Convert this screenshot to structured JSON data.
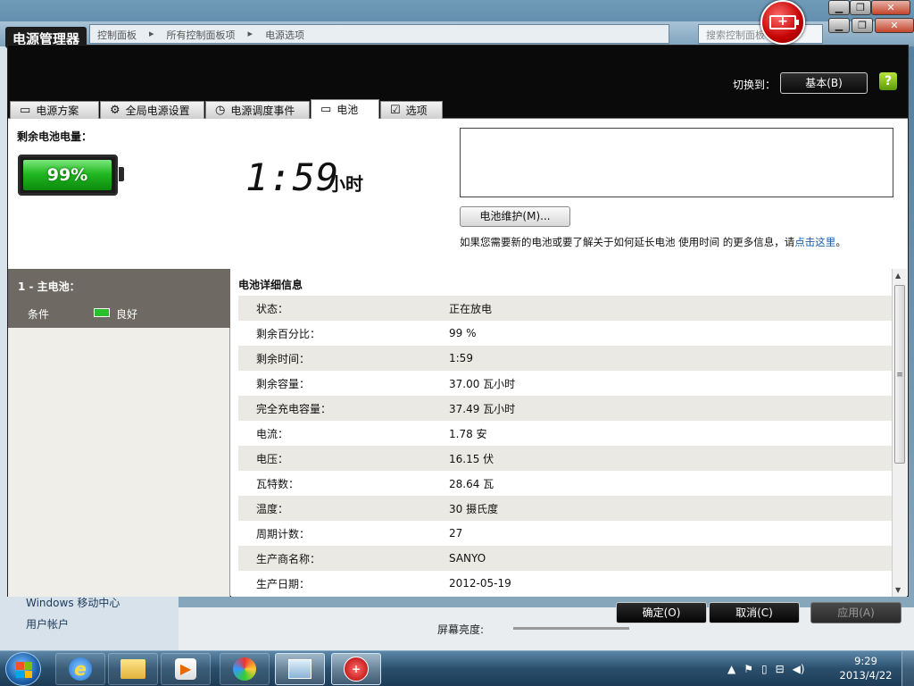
{
  "background_window": {
    "breadcrumb": [
      "控制面板",
      "所有控制面板项",
      "电源选项"
    ],
    "search_placeholder": "搜索控制面板",
    "sidebar_items": [
      "Windows 移动中心",
      "用户帐户"
    ],
    "brightness_label": "屏幕亮度:"
  },
  "dialog": {
    "title": "电源管理器",
    "switch_label": "切换到：",
    "basic_button": "基本(B)",
    "help_icon": "?",
    "tabs": [
      {
        "label": "电源方案",
        "icon": "plan-icon"
      },
      {
        "label": "全局电源设置",
        "icon": "gear-icon"
      },
      {
        "label": "电源调度事件",
        "icon": "schedule-icon"
      },
      {
        "label": "电池",
        "icon": "battery-icon"
      },
      {
        "label": "选项",
        "icon": "checkbox-icon"
      }
    ],
    "active_tab": "电池"
  },
  "battery_summary": {
    "remaining_label": "剩余电池电量：",
    "percent_text": "99%",
    "charge_level_percent": 99,
    "time_remaining": "1:59",
    "time_unit": "小时",
    "maintenance_button": "电池维护(M)...",
    "extend_text": "如果您需要新的电池或要了解关于如何延长电池 使用时间 的更多信息，请",
    "extend_link": "点击这里",
    "extend_end": "。"
  },
  "battery_list": {
    "title": "1 - 主电池：",
    "condition_label": "条件",
    "condition_value": "良好"
  },
  "details": {
    "heading": "电池详细信息",
    "rows": [
      {
        "key": "状态：",
        "value": "正在放电"
      },
      {
        "key": "剩余百分比：",
        "value": "99 %"
      },
      {
        "key": "剩余时间：",
        "value": "1:59"
      },
      {
        "key": "剩余容量：",
        "value": "37.00 瓦小时"
      },
      {
        "key": "完全充电容量：",
        "value": "37.49 瓦小时"
      },
      {
        "key": "电流：",
        "value": "1.78 安"
      },
      {
        "key": "电压：",
        "value": "16.15 伏"
      },
      {
        "key": "瓦特数：",
        "value": "28.64 瓦"
      },
      {
        "key": "温度：",
        "value": "30 摄氏度"
      },
      {
        "key": "周期计数：",
        "value": "27"
      },
      {
        "key": "生产商名称：",
        "value": "SANYO"
      },
      {
        "key": "生产日期：",
        "value": "2012-05-19"
      }
    ]
  },
  "buttons": {
    "ok": "确定(O)",
    "cancel": "取消(C)",
    "apply": "应用(A)"
  },
  "taskbar": {
    "time": "9:29",
    "date": "2013/4/22",
    "apps": [
      "ie-icon",
      "explorer-icon",
      "media-player-icon",
      "paint-icon",
      "control-panel-icon",
      "battery-manager-icon"
    ]
  }
}
